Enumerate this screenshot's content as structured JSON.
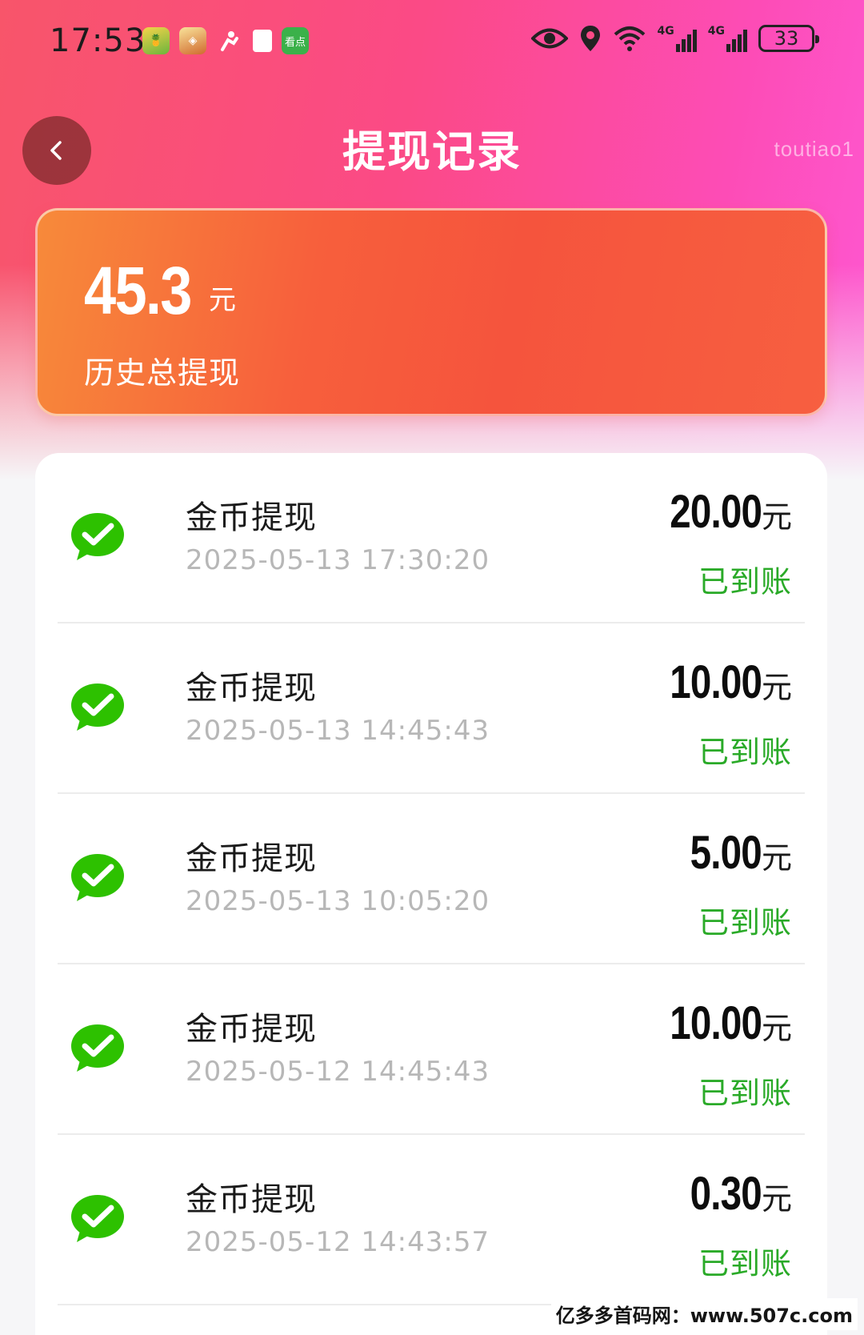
{
  "status_bar": {
    "time": "17:53",
    "app_icons": [
      "pineapple-app-icon",
      "game-app-icon",
      "person-app-icon",
      "book-app-icon",
      "kandian-app-icon"
    ],
    "kandian_icon_text": "看点",
    "indicators": [
      "eye-icon",
      "location-icon",
      "wifi-icon",
      "signal-4g-icon",
      "signal-4g-icon"
    ],
    "signal_label": "4G",
    "battery": "33"
  },
  "header": {
    "title": "提现记录",
    "user_tag": "toutiao1",
    "back_icon": "chevron-left-icon"
  },
  "summary": {
    "total_amount": "45.3",
    "unit": "元",
    "label": "历史总提现"
  },
  "records": [
    {
      "title": "金币提现",
      "time": "2025-05-13 17:30:20",
      "amount": "20.00",
      "unit": "元",
      "status": "已到账"
    },
    {
      "title": "金币提现",
      "time": "2025-05-13 14:45:43",
      "amount": "10.00",
      "unit": "元",
      "status": "已到账"
    },
    {
      "title": "金币提现",
      "time": "2025-05-13 10:05:20",
      "amount": "5.00",
      "unit": "元",
      "status": "已到账"
    },
    {
      "title": "金币提现",
      "time": "2025-05-12 14:45:43",
      "amount": "10.00",
      "unit": "元",
      "status": "已到账"
    },
    {
      "title": "金币提现",
      "time": "2025-05-12 14:43:57",
      "amount": "0.30",
      "unit": "元",
      "status": "已到账"
    }
  ],
  "watermark": "亿多多首码网：www.507c.com",
  "colors": {
    "accent_pink": "#fb4a86",
    "card_orange": "#f5543d",
    "status_green": "#2aaa28",
    "wechat_green": "#2dc100"
  }
}
